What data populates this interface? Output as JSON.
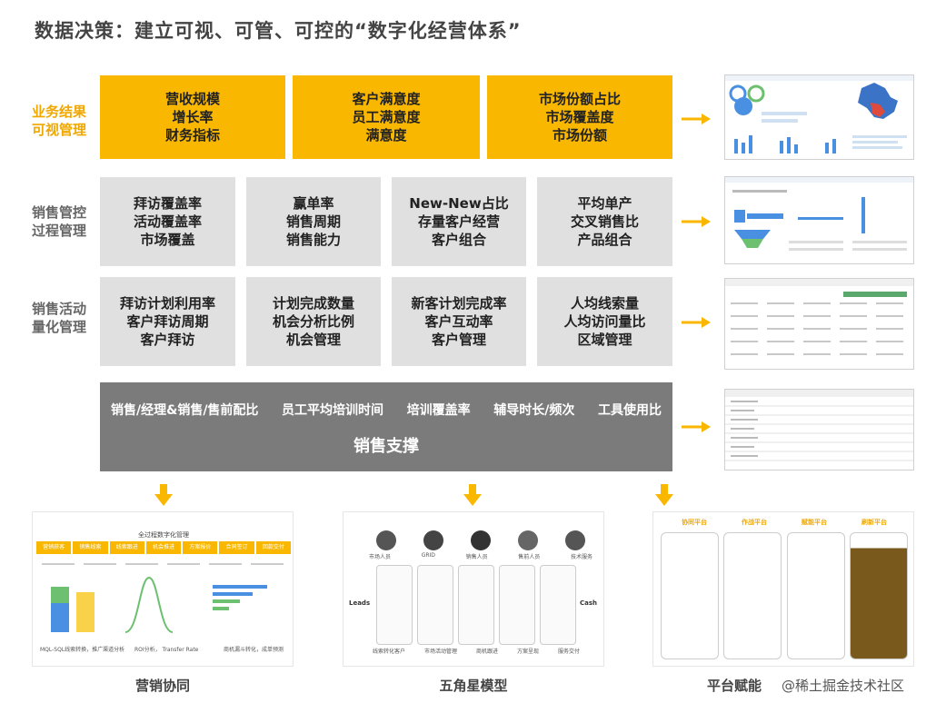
{
  "title": "数据决策：建立可视、可管、可控的“数字化经营体系”",
  "rows": [
    {
      "label_line1": "业务结果",
      "label_line2": "可视管理",
      "label_color": "#f0a800"
    },
    {
      "label_line1": "销售管控",
      "label_line2": "过程管理",
      "label_color": "#666666"
    },
    {
      "label_line1": "销售活动",
      "label_line2": "量化管理",
      "label_color": "#666666"
    }
  ],
  "row1_boxes": [
    {
      "lines": [
        "营收规模",
        "增长率",
        "财务指标"
      ]
    },
    {
      "lines": [
        "客户满意度",
        "员工满意度",
        "满意度"
      ]
    },
    {
      "lines": [
        "市场份额占比",
        "市场覆盖度",
        "市场份额"
      ]
    }
  ],
  "row2_boxes": [
    {
      "lines": [
        "拜访覆盖率",
        "活动覆盖率",
        "市场覆盖"
      ]
    },
    {
      "lines": [
        "赢单率",
        "销售周期",
        "销售能力"
      ]
    },
    {
      "lines": [
        "New-New占比",
        "存量客户经营",
        "客户组合"
      ]
    },
    {
      "lines": [
        "平均单产",
        "交叉销售比",
        "产品组合"
      ]
    }
  ],
  "row3_boxes": [
    {
      "lines": [
        "拜访计划利用率",
        "客户拜访周期",
        "客户拜访"
      ]
    },
    {
      "lines": [
        "计划完成数量",
        "机会分析比例",
        "机会管理"
      ]
    },
    {
      "lines": [
        "新客计划完成率",
        "客户互动率",
        "客户管理"
      ]
    },
    {
      "lines": [
        "人均线索量",
        "人均访问量比",
        "区域管理"
      ]
    }
  ],
  "support": {
    "items": [
      "销售/经理&销售/售前配比",
      "员工平均培训时间",
      "培训覆盖率",
      "辅导时长/频次",
      "工具使用比"
    ],
    "title": "销售支撑"
  },
  "bottom": {
    "labels": [
      "营销协同",
      "五角星模型",
      "平台赋能"
    ],
    "marketing": {
      "header": "全过程数字化管理",
      "stages": [
        "营销获客",
        "销售线索",
        "线索跟进",
        "机会推进",
        "方案报价",
        "合同签订",
        "回款交付"
      ],
      "footer_left": "MQL-SQL线索转换，推广渠道分析",
      "footer_mid": "ROI分析， Transfer Rate",
      "footer_right": "商机漏斗转化，成单预测"
    },
    "star": {
      "roles": [
        "市场人员",
        "GRID",
        "销售人员",
        "售前人员",
        "技术服务"
      ],
      "left": "Leads",
      "right": "Cash",
      "steps": [
        "线索转化客户",
        "市场活动管理",
        "商机跟进",
        "方案呈现",
        "服务交付"
      ]
    },
    "platform": {
      "tabs": [
        "协同平台",
        "作战平台",
        "赋能平台",
        "刷新平台"
      ]
    }
  },
  "watermark": "@稀土掘金技术社区",
  "colors": {
    "accent": "#f9b700",
    "gray_box": "#e0e0e0",
    "dark_box": "#7b7b7b"
  }
}
